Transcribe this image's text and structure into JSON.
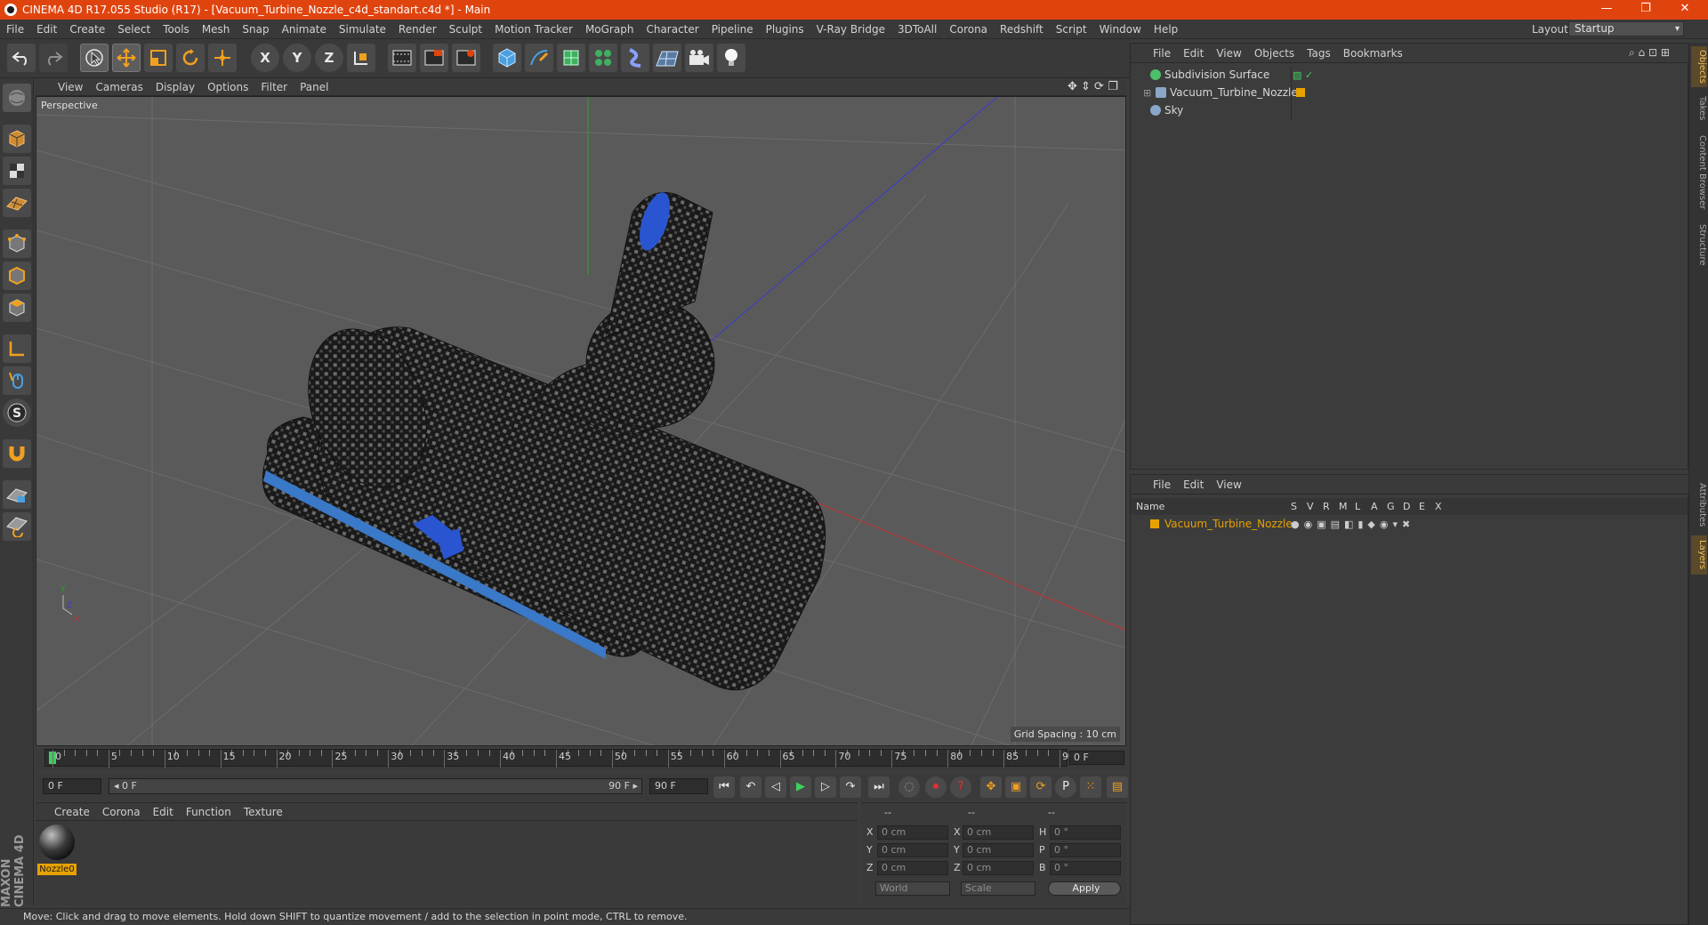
{
  "window": {
    "title": "CINEMA 4D R17.055 Studio (R17) - [Vacuum_Turbine_Nozzle_c4d_standart.c4d *] - Main",
    "controls": [
      "—",
      "❐",
      "✕"
    ]
  },
  "menu": {
    "items": [
      "File",
      "Edit",
      "Create",
      "Select",
      "Tools",
      "Mesh",
      "Snap",
      "Animate",
      "Simulate",
      "Render",
      "Sculpt",
      "Motion Tracker",
      "MoGraph",
      "Character",
      "Pipeline",
      "Plugins",
      "V-Ray Bridge",
      "3DToAll",
      "Corona",
      "Redshift",
      "Script",
      "Window",
      "Help"
    ],
    "layout_label": "Layout:",
    "layout_value": "Startup"
  },
  "toolbar": {
    "axis_x": "X",
    "axis_y": "Y",
    "axis_z": "Z",
    "icons": [
      "undo-icon",
      "redo-icon",
      "live-select-icon",
      "move-icon",
      "scale-icon",
      "rotate-icon",
      "transform-icon",
      "x-axis-icon",
      "y-axis-icon",
      "z-axis-icon",
      "coordinate-system-icon",
      "render-view-icon",
      "render-picture-viewer-icon",
      "render-settings-icon",
      "cube-icon",
      "pen-icon",
      "subdivision-icon",
      "cloner-icon",
      "deformer-icon",
      "floor-icon",
      "camera-icon",
      "light-icon"
    ]
  },
  "left_tools": {
    "icons": [
      "model-mode-icon",
      "object-mode-icon",
      "texture-mode-icon",
      "workplane-icon",
      "points-mode-icon",
      "edges-mode-icon",
      "polygons-mode-icon",
      "axis-mode-icon",
      "tweak-icon",
      "solo-icon",
      "snap-icon",
      "lock-workplane-icon",
      "grid-snap-icon"
    ]
  },
  "viewport": {
    "menu": [
      "View",
      "Cameras",
      "Display",
      "Options",
      "Filter",
      "Panel"
    ],
    "label": "Perspective",
    "grid_spacing": "Grid Spacing : 10 cm",
    "axis_labels": {
      "y": "Y",
      "x": "X",
      "z": "Z"
    }
  },
  "timeline": {
    "ticks": [
      "0",
      "5",
      "10",
      "15",
      "20",
      "25",
      "30",
      "35",
      "40",
      "45",
      "50",
      "55",
      "60",
      "65",
      "70",
      "75",
      "80",
      "85",
      "90"
    ],
    "current_frame": "0 F"
  },
  "playback": {
    "start": "0 F",
    "range_start": "◂ 0 F",
    "range_end": "90 F ▸",
    "end": "90 F"
  },
  "material_manager": {
    "menu": [
      "Create",
      "Corona",
      "Edit",
      "Function",
      "Texture"
    ],
    "material_name": "Nozzle0"
  },
  "coordinates": {
    "headers": [
      "--",
      "--",
      "--"
    ],
    "rows": [
      {
        "a": "X",
        "av": "0 cm",
        "b": "X",
        "bv": "0 cm",
        "c": "H",
        "cv": "0 °"
      },
      {
        "a": "Y",
        "av": "0 cm",
        "b": "Y",
        "bv": "0 cm",
        "c": "P",
        "cv": "0 °"
      },
      {
        "a": "Z",
        "av": "0 cm",
        "b": "Z",
        "bv": "0 cm",
        "c": "B",
        "cv": "0 °"
      }
    ],
    "mode1": "World",
    "mode2": "Scale",
    "apply": "Apply"
  },
  "status": "Move: Click and drag to move elements. Hold down SHIFT to quantize movement / add to the selection in point mode, CTRL to remove.",
  "branding": "MAXON CINEMA 4D",
  "object_manager": {
    "menu": [
      "File",
      "Edit",
      "View",
      "Objects",
      "Tags",
      "Bookmarks"
    ],
    "objects": [
      {
        "name": "Subdivision Surface",
        "color": "#4fc06a"
      },
      {
        "name": "Vacuum_Turbine_Nozzle",
        "color": "#e8a200"
      },
      {
        "name": "Sky",
        "color": "#8aa6c8"
      }
    ]
  },
  "layer_manager": {
    "menu": [
      "File",
      "Edit",
      "View"
    ],
    "columns": [
      "Name",
      "S",
      "V",
      "R",
      "M",
      "L",
      "A",
      "G",
      "D",
      "E",
      "X"
    ],
    "layer_name": "Vacuum_Turbine_Nozzle",
    "layer_color": "#e8a200"
  },
  "right_tabs": [
    "Objects",
    "Takes",
    "Content Browser",
    "Structure",
    "Attributes",
    "Layers"
  ],
  "colors": {
    "accent": "#e0440e",
    "selection": "#e8a200",
    "x_axis": "#c83232",
    "y_axis": "#2ea02e",
    "z_axis": "#3a3ad0"
  }
}
